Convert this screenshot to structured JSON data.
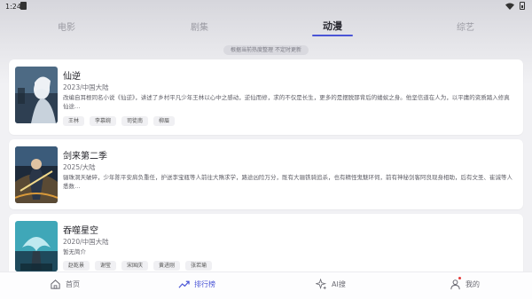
{
  "status": {
    "time": "1:24"
  },
  "top_tabs": [
    {
      "label": "电影"
    },
    {
      "label": "剧集"
    },
    {
      "label": "动漫"
    },
    {
      "label": "综艺"
    }
  ],
  "notice": "根据当前热度整理 不定时更新",
  "cards": [
    {
      "title": "仙逆",
      "meta": "2023/中国大陆",
      "desc": "改编自耳根同名小说《仙逆》，讲述了乡村平凡少年王林以心中之感动，逆仙而修，求的不仅是长生，更多的是摆脱那背后的蝼蚁之身。他坚信道在人为，以平庸的资质踏入修真仙途…",
      "tags": [
        "王林",
        "李慕婉",
        "司徒南",
        "柳眉"
      ]
    },
    {
      "title": "剑来第二季",
      "meta": "2025/大陆",
      "desc": "骊珠洞天破碎，少年陈平安肩负重任，护送李宝瓶等人前往大隋求学，路途凶险万分，既有大骊铁骑追杀，也有精怪鬼魅环伺，前有神秘剑客阿良现身相助，后有文圣、崔诚等人悉数…",
      "tags": []
    },
    {
      "title": "吞噬星空",
      "meta": "2020/中国大陆",
      "desc": "暂无简介",
      "tags": [
        "赵乾景",
        "谢莹",
        "宋国庆",
        "黄进刚",
        "张若瑜"
      ]
    }
  ],
  "bottom_nav": [
    {
      "label": "首页",
      "icon": "home-icon"
    },
    {
      "label": "排行榜",
      "icon": "trending-icon"
    },
    {
      "label": "AI搜",
      "icon": "sparkle-icon"
    },
    {
      "label": "我的",
      "icon": "person-icon"
    }
  ],
  "colors": {
    "accent": "#4a55d6",
    "badge_dot": "#e53b3b"
  }
}
